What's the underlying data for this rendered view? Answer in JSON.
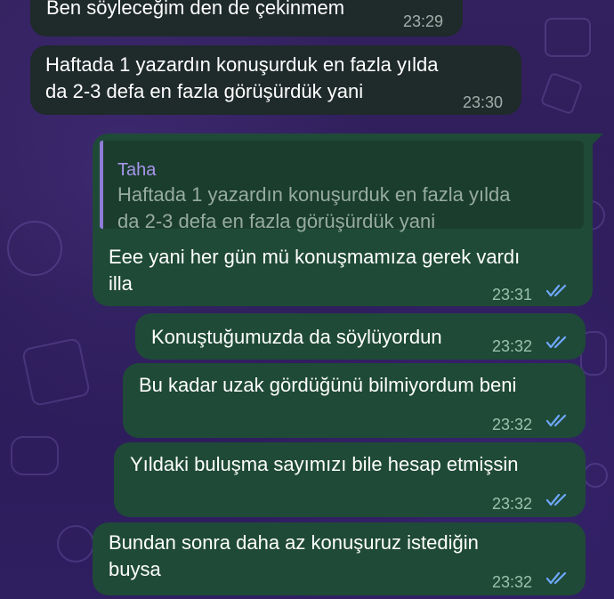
{
  "theme": {
    "background": "#2f1d5e",
    "incoming_bubble": "#1f2a2a",
    "outgoing_bubble": "#1f4a37",
    "quote_accent": "#8f7bd6",
    "read_ticks": "#6fa8ff"
  },
  "messages": [
    {
      "direction": "incoming",
      "lines": [
        "Ben söyleceğim den de çekinmem"
      ],
      "time": "23:29"
    },
    {
      "direction": "incoming",
      "lines": [
        "Haftada 1 yazardın konuşurduk en fazla yılda",
        "da 2-3 defa en fazla görüşürdük yani"
      ],
      "time": "23:30"
    },
    {
      "direction": "outgoing",
      "reply_to": {
        "author": "Taha",
        "lines": [
          "Haftada 1 yazardın konuşurduk en fazla yılda",
          "da 2-3 defa en fazla görüşürdük yani"
        ]
      },
      "lines": [
        "Eee yani her gün mü konuşmamıza gerek vardı",
        "illa"
      ],
      "time": "23:31",
      "status_icon": "double-check-read-icon"
    },
    {
      "direction": "outgoing",
      "lines": [
        "Konuştuğumuzda da söylüyordun"
      ],
      "time": "23:32",
      "status_icon": "double-check-read-icon"
    },
    {
      "direction": "outgoing",
      "lines": [
        "Bu kadar uzak gördüğünü bilmiyordum beni"
      ],
      "time": "23:32",
      "status_icon": "double-check-read-icon"
    },
    {
      "direction": "outgoing",
      "lines": [
        "Yıldaki buluşma sayımızı bile hesap etmişsin"
      ],
      "time": "23:32",
      "status_icon": "double-check-read-icon"
    },
    {
      "direction": "outgoing",
      "lines": [
        "Bundan sonra daha az konuşuruz istediğin",
        "buysa"
      ],
      "time": "23:32",
      "status_icon": "double-check-read-icon"
    }
  ]
}
